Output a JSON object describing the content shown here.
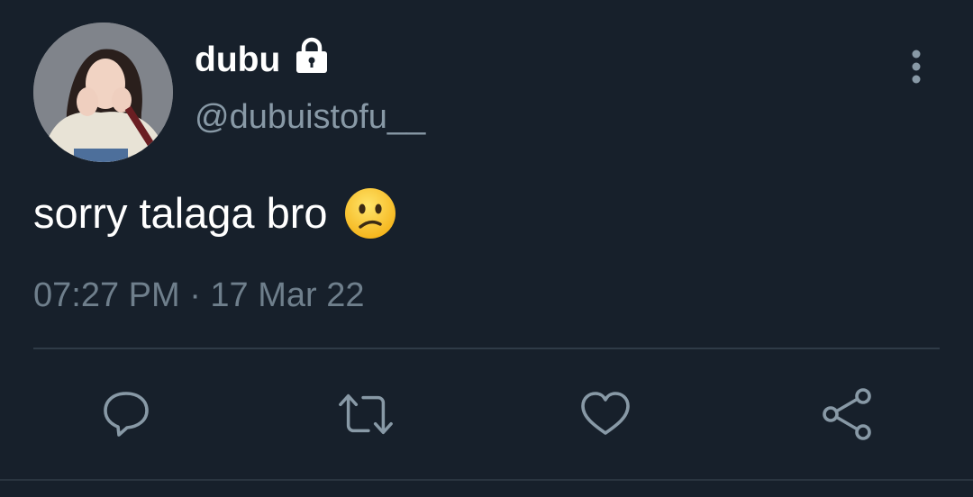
{
  "tweet": {
    "display_name": "dubu",
    "handle": "@dubuistofu__",
    "text": "sorry talaga bro",
    "timestamp": "07:27 PM · 17 Mar 22",
    "emoji": "confused-face-emoji",
    "locked_icon": "lock-icon",
    "more_icon": "more-vertical-icon"
  },
  "actions": {
    "reply_icon": "reply-icon",
    "retweet_icon": "retweet-icon",
    "like_icon": "heart-icon",
    "share_icon": "share-icon"
  },
  "colors": {
    "background": "#17202b",
    "primary_text": "#ffffff",
    "secondary_text": "#8899a6",
    "icon": "#8899a6",
    "divider": "#2f3b47"
  }
}
